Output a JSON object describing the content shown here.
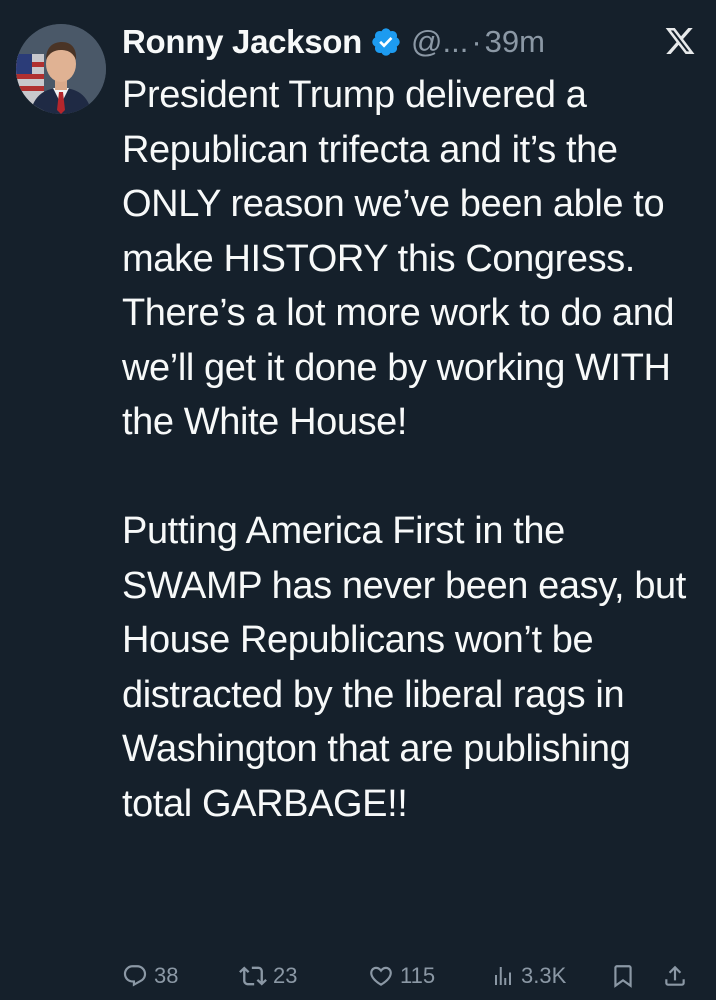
{
  "tweet": {
    "display_name": "Ronny Jackson",
    "handle": "@...",
    "separator": "·",
    "time": "39m",
    "paragraphs": [
      "President Trump delivered a Republican trifecta and it’s the ONLY reason we’ve been able to make HISTORY this Congress. There’s a lot more work to do and we’ll get it done by working WITH the White House!",
      "Putting America First in the SWAMP has never been easy, but House Republicans won’t be distracted by the liberal rags in Washington that are publishing total GARBAGE!!"
    ],
    "icons": {
      "avatar": "avatar",
      "verified": "verified-badge-icon",
      "logo": "x-logo-icon"
    },
    "colors": {
      "background": "#15202b",
      "text": "#f7f9f9",
      "muted": "#8b98a5",
      "verified": "#1d9bf0"
    }
  },
  "actions": {
    "replies": "38",
    "reposts": "23",
    "likes": "115",
    "views": "3.3K"
  }
}
